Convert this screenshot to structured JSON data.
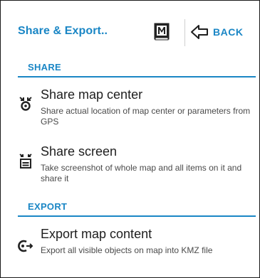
{
  "header": {
    "title": "Share & Export..",
    "back_label": "BACK"
  },
  "sections": {
    "share": "SHARE",
    "export": "EXPORT"
  },
  "items": [
    {
      "title": "Share map center",
      "description": "Share actual location of map center or parameters from GPS",
      "icon": "share-location-icon"
    },
    {
      "title": "Share screen",
      "description": "Take screenshot of whole map and all items on it and share it",
      "icon": "share-screen-icon"
    },
    {
      "title": "Export map content",
      "description": "Export all visible objects on map into KMZ file",
      "icon": "export-icon"
    }
  ],
  "colors": {
    "accent": "#1a86c5",
    "text": "#1e1e1e",
    "secondary_text": "#4a4a4a"
  }
}
